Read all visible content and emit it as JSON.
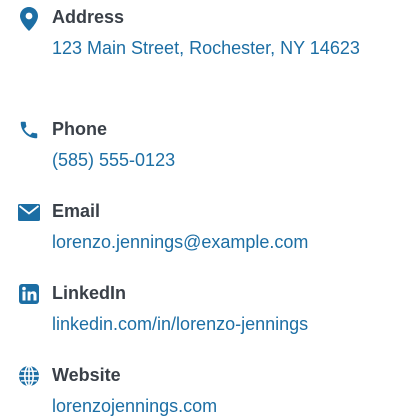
{
  "accent_color": "#1c6ea4",
  "label_color": "#3a4048",
  "contacts": {
    "address": {
      "icon": "map-pin-icon",
      "label": "Address",
      "value": "123 Main Street, Rochester, NY 14623"
    },
    "phone": {
      "icon": "phone-icon",
      "label": "Phone",
      "value": "(585) 555-0123"
    },
    "email": {
      "icon": "envelope-icon",
      "label": "Email",
      "value": "lorenzo.jennings@example.com"
    },
    "linkedin": {
      "icon": "linkedin-icon",
      "label": "LinkedIn",
      "value": "linkedin.com/in/lorenzo-jennings"
    },
    "website": {
      "icon": "globe-icon",
      "label": "Website",
      "value": "lorenzojennings.com"
    }
  }
}
